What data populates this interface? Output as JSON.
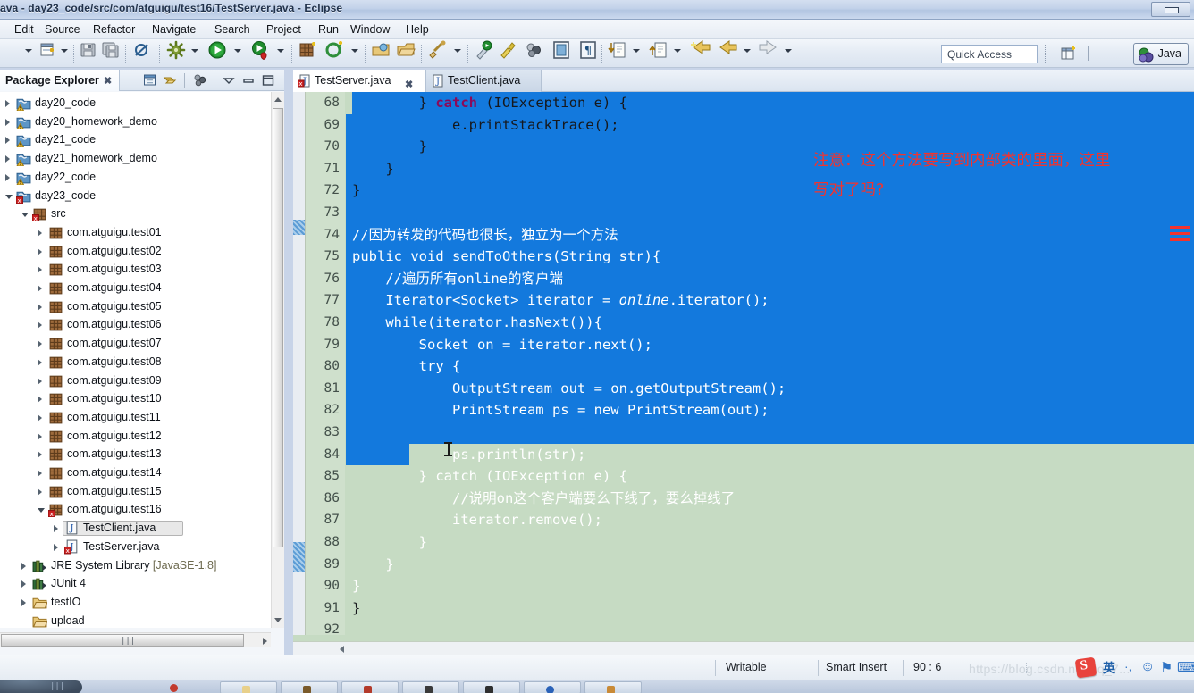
{
  "window": {
    "title": "ava - day23_code/src/com/atguigu/test16/TestServer.java - Eclipse",
    "restore_label": "restore-window"
  },
  "menubar": {
    "items": [
      "Edit",
      "Source",
      "Refactor",
      "Navigate",
      "Search",
      "Project",
      "Run",
      "Window",
      "Help"
    ]
  },
  "toolbar": {
    "icons": [
      "new-wizard-icon",
      "save-icon",
      "save-all-icon",
      "toggle-breakpoint-icon",
      "debug-icon",
      "run-icon",
      "run-coverage-icon",
      "new-java-package-icon",
      "new-java-class-icon",
      "open-type-icon",
      "search-icon",
      "external-tools-icon",
      "java-editor-icon",
      "toggle-ant-icon",
      "show-whitespace-icon",
      "next-annotation-icon",
      "previous-annotation-icon",
      "last-edit-location-icon",
      "back-icon",
      "forward-icon"
    ],
    "quick_access_placeholder": "Quick Access",
    "open-perspective-icon": "open-perspective-icon",
    "perspective_label": "Java"
  },
  "package_explorer": {
    "title": "Package Explorer",
    "close_glyph": "✖",
    "toolbar_icons": [
      "link-with-editor-icon",
      "collapse-all-icon",
      "view-menu-filter-icon",
      "view-menu-icon",
      "minimize-icon",
      "maximize-icon"
    ],
    "tree": [
      {
        "label": "day20_code",
        "indent": 0,
        "twisty": "closed",
        "icon": "java-project-warning-icon"
      },
      {
        "label": "day20_homework_demo",
        "indent": 0,
        "twisty": "closed",
        "icon": "java-project-warning-icon"
      },
      {
        "label": "day21_code",
        "indent": 0,
        "twisty": "closed",
        "icon": "java-project-warning-icon"
      },
      {
        "label": "day21_homework_demo",
        "indent": 0,
        "twisty": "closed",
        "icon": "java-project-warning-icon"
      },
      {
        "label": "day22_code",
        "indent": 0,
        "twisty": "closed",
        "icon": "java-project-warning-icon"
      },
      {
        "label": "day23_code",
        "indent": 0,
        "twisty": "open",
        "icon": "java-project-error-icon"
      },
      {
        "label": "src",
        "indent": 1,
        "twisty": "open",
        "icon": "source-folder-error-icon"
      },
      {
        "label": "com.atguigu.test01",
        "indent": 2,
        "twisty": "closed",
        "icon": "package-icon"
      },
      {
        "label": "com.atguigu.test02",
        "indent": 2,
        "twisty": "closed",
        "icon": "package-icon"
      },
      {
        "label": "com.atguigu.test03",
        "indent": 2,
        "twisty": "closed",
        "icon": "package-icon"
      },
      {
        "label": "com.atguigu.test04",
        "indent": 2,
        "twisty": "closed",
        "icon": "package-icon"
      },
      {
        "label": "com.atguigu.test05",
        "indent": 2,
        "twisty": "closed",
        "icon": "package-icon"
      },
      {
        "label": "com.atguigu.test06",
        "indent": 2,
        "twisty": "closed",
        "icon": "package-icon"
      },
      {
        "label": "com.atguigu.test07",
        "indent": 2,
        "twisty": "closed",
        "icon": "package-icon"
      },
      {
        "label": "com.atguigu.test08",
        "indent": 2,
        "twisty": "closed",
        "icon": "package-icon"
      },
      {
        "label": "com.atguigu.test09",
        "indent": 2,
        "twisty": "closed",
        "icon": "package-icon"
      },
      {
        "label": "com.atguigu.test10",
        "indent": 2,
        "twisty": "closed",
        "icon": "package-icon"
      },
      {
        "label": "com.atguigu.test11",
        "indent": 2,
        "twisty": "closed",
        "icon": "package-icon"
      },
      {
        "label": "com.atguigu.test12",
        "indent": 2,
        "twisty": "closed",
        "icon": "package-icon"
      },
      {
        "label": "com.atguigu.test13",
        "indent": 2,
        "twisty": "closed",
        "icon": "package-icon"
      },
      {
        "label": "com.atguigu.test14",
        "indent": 2,
        "twisty": "closed",
        "icon": "package-icon"
      },
      {
        "label": "com.atguigu.test15",
        "indent": 2,
        "twisty": "closed",
        "icon": "package-icon"
      },
      {
        "label": "com.atguigu.test16",
        "indent": 2,
        "twisty": "open",
        "icon": "package-error-icon"
      },
      {
        "label": "TestClient.java",
        "indent": 3,
        "twisty": "closed",
        "icon": "java-file-icon",
        "selected": true
      },
      {
        "label": "TestServer.java",
        "indent": 3,
        "twisty": "closed",
        "icon": "java-file-error-icon"
      },
      {
        "label": "JRE System Library [JavaSE-1.8]",
        "indent": 1,
        "twisty": "closed",
        "icon": "library-icon"
      },
      {
        "label": "JUnit 4",
        "indent": 1,
        "twisty": "closed",
        "icon": "library-icon"
      },
      {
        "label": "testIO",
        "indent": 1,
        "twisty": "closed",
        "icon": "folder-icon"
      },
      {
        "label": "upload",
        "indent": 1,
        "twisty": "none",
        "icon": "folder-icon"
      }
    ]
  },
  "editor": {
    "tabs": [
      {
        "label": "TestServer.java",
        "active": true,
        "icon": "java-file-error-icon",
        "close_glyph": "✖"
      },
      {
        "label": "TestClient.java",
        "active": false,
        "icon": "java-file-icon"
      }
    ],
    "first_line": 68,
    "lines": [
      {
        "n": 68,
        "segments": [
          {
            "t": "        } ",
            "c": "plain"
          },
          {
            "t": "catch ",
            "c": "kw"
          },
          {
            "t": "(IOException e) {",
            "c": "plain"
          }
        ]
      },
      {
        "n": 69,
        "segments": [
          {
            "t": "            e.printStackTrace();",
            "c": "plain"
          }
        ]
      },
      {
        "n": 70,
        "segments": [
          {
            "t": "        }",
            "c": "plain"
          }
        ]
      },
      {
        "n": 71,
        "segments": [
          {
            "t": "    }",
            "c": "plain"
          }
        ]
      },
      {
        "n": 72,
        "segments": [
          {
            "t": "}",
            "c": "plain"
          }
        ]
      },
      {
        "n": 73,
        "segments": []
      },
      {
        "n": 74,
        "segments": [
          {
            "t": "//因为转发的代码也很长，独立为一个方法",
            "c": "sel-cmt"
          }
        ],
        "selected": true
      },
      {
        "n": 75,
        "segments": [
          {
            "t": "public void sendToOthers(String str){",
            "c": "sel"
          }
        ],
        "selected": true,
        "fold": true
      },
      {
        "n": 76,
        "segments": [
          {
            "t": "    //遍历所有online的客户端",
            "c": "sel-cmt"
          }
        ],
        "selected": true
      },
      {
        "n": 77,
        "segments": [
          {
            "t": "    Iterator<Socket> iterator = ",
            "c": "sel"
          },
          {
            "t": "online",
            "c": "sel-ital"
          },
          {
            "t": ".iterator();",
            "c": "sel"
          }
        ],
        "selected": true
      },
      {
        "n": 78,
        "segments": [
          {
            "t": "    while(iterator.hasNext()){",
            "c": "sel"
          }
        ],
        "selected": true
      },
      {
        "n": 79,
        "segments": [
          {
            "t": "        Socket on = iterator.next();",
            "c": "sel"
          }
        ],
        "selected": true
      },
      {
        "n": 80,
        "segments": [
          {
            "t": "        try {",
            "c": "sel"
          }
        ],
        "selected": true
      },
      {
        "n": 81,
        "segments": [
          {
            "t": "            OutputStream out = on.getOutputStream();",
            "c": "sel"
          }
        ],
        "selected": true
      },
      {
        "n": 82,
        "segments": [
          {
            "t": "            PrintStream ps = new PrintStream(out);",
            "c": "sel"
          }
        ],
        "selected": true
      },
      {
        "n": 83,
        "segments": [],
        "selected": true
      },
      {
        "n": 84,
        "segments": [
          {
            "t": "            ps.println(str);",
            "c": "sel"
          }
        ],
        "selected": true
      },
      {
        "n": 85,
        "segments": [
          {
            "t": "        } catch (IOException e) {",
            "c": "sel"
          }
        ],
        "selected": true
      },
      {
        "n": 86,
        "segments": [
          {
            "t": "            //说明on这个客户端要么下线了，要么掉线了",
            "c": "sel-cmt"
          }
        ],
        "selected": true
      },
      {
        "n": 87,
        "segments": [
          {
            "t": "            iterator.remove();",
            "c": "sel"
          }
        ],
        "selected": true
      },
      {
        "n": 88,
        "segments": [
          {
            "t": "        }",
            "c": "sel"
          }
        ],
        "selected": true
      },
      {
        "n": 89,
        "segments": [
          {
            "t": "    }",
            "c": "sel"
          }
        ],
        "selected": true
      },
      {
        "n": 90,
        "segments": [
          {
            "t": "}",
            "c": "sel"
          }
        ],
        "selected": true,
        "partial": true
      },
      {
        "n": 91,
        "segments": [
          {
            "t": "}",
            "c": "plain"
          }
        ]
      },
      {
        "n": 92,
        "segments": []
      }
    ],
    "annotation": {
      "line1": "注意：这个方法要写到内部类的里面，这里",
      "line2": "写对了吗?",
      "color": "#f2332e"
    }
  },
  "statusbar": {
    "writable": "Writable",
    "insert_mode": "Smart Insert",
    "cursor_position": "90 : 6",
    "watermark": "https://blog.csdn.net/qq_7...",
    "ime": {
      "logo": "sogou-pinyin-icon",
      "items": [
        "英",
        "·,",
        "☺",
        "⚑",
        "⌨",
        "▤"
      ]
    }
  },
  "colors": {
    "editor_background": "#c6dbc3",
    "selection_background": "#1379dd",
    "gutter_background": "#cfe0cc",
    "annotation_red": "#f2332e",
    "keyword_magenta": "#8b0a5a"
  }
}
